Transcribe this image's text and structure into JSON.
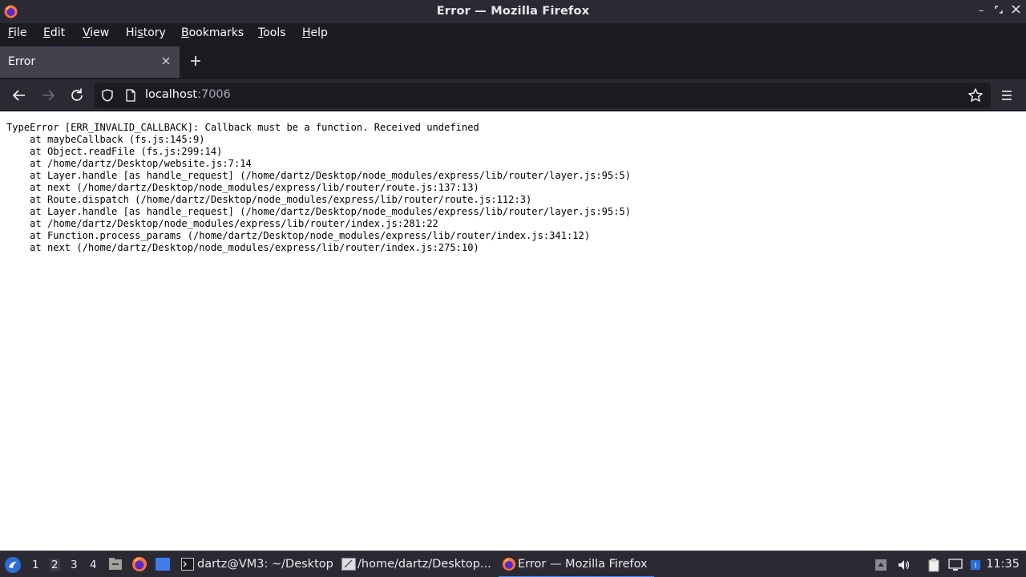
{
  "window": {
    "title": "Error — Mozilla Firefox"
  },
  "menu": {
    "items": [
      {
        "label": "File",
        "mnemonic": "F",
        "rest": "ile"
      },
      {
        "label": "Edit",
        "mnemonic": "E",
        "rest": "dit"
      },
      {
        "label": "View",
        "mnemonic": "V",
        "rest": "iew"
      },
      {
        "label": "History",
        "pre": "Hi",
        "mnemonic": "s",
        "rest": "tory"
      },
      {
        "label": "Bookmarks",
        "mnemonic": "B",
        "rest": "ookmarks"
      },
      {
        "label": "Tools",
        "mnemonic": "T",
        "rest": "ools"
      },
      {
        "label": "Help",
        "mnemonic": "H",
        "rest": "elp"
      }
    ]
  },
  "tabs": [
    {
      "label": "Error",
      "active": true
    }
  ],
  "nav": {
    "url_host": "localhost",
    "url_port": ":7006"
  },
  "page": {
    "error_lines": [
      "TypeError [ERR_INVALID_CALLBACK]: Callback must be a function. Received undefined",
      "    at maybeCallback (fs.js:145:9)",
      "    at Object.readFile (fs.js:299:14)",
      "    at /home/dartz/Desktop/website.js:7:14",
      "    at Layer.handle [as handle_request] (/home/dartz/Desktop/node_modules/express/lib/router/layer.js:95:5)",
      "    at next (/home/dartz/Desktop/node_modules/express/lib/router/route.js:137:13)",
      "    at Route.dispatch (/home/dartz/Desktop/node_modules/express/lib/router/route.js:112:3)",
      "    at Layer.handle [as handle_request] (/home/dartz/Desktop/node_modules/express/lib/router/layer.js:95:5)",
      "    at /home/dartz/Desktop/node_modules/express/lib/router/index.js:281:22",
      "    at Function.process_params (/home/dartz/Desktop/node_modules/express/lib/router/index.js:341:12)",
      "    at next (/home/dartz/Desktop/node_modules/express/lib/router/index.js:275:10)"
    ]
  },
  "taskbar": {
    "workspaces": [
      "1",
      "2",
      "3",
      "4"
    ],
    "active_workspace": "2",
    "tasks": [
      {
        "label": "dartz@VM3: ~/Desktop",
        "icon": "terminal-icon"
      },
      {
        "label": "/home/dartz/Desktop...",
        "icon": "text-editor-icon"
      },
      {
        "label": "Error — Mozilla Firefox",
        "icon": "firefox-icon",
        "active": true
      }
    ],
    "clock": "11:35"
  },
  "colors": {
    "chrome_dark": "#1c1b22",
    "chrome": "#2b2a33",
    "tab_active": "#42414d",
    "taskbar_accent": "#3e86ff"
  }
}
